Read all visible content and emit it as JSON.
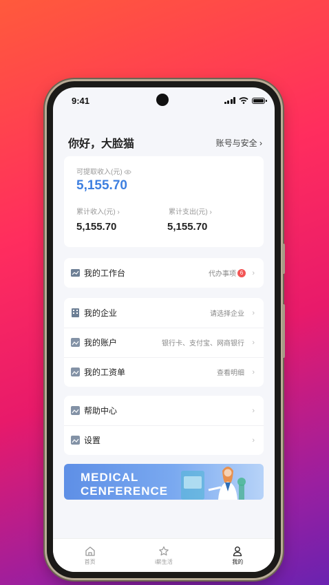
{
  "status": {
    "time": "9:41"
  },
  "header": {
    "greeting": "你好，大脸猫",
    "account_link": "账号与安全"
  },
  "summary": {
    "withdrawable_label": "可提取收入(元)",
    "withdrawable_value": "5,155.70",
    "total_income_label": "累计收入(元)",
    "total_income_value": "5,155.70",
    "total_expense_label": "累计支出(元)",
    "total_expense_value": "5,155.70"
  },
  "workbench": {
    "title": "我的工作台",
    "todo_label": "代办事项",
    "todo_count": "6"
  },
  "menu_group_1": {
    "enterprise": {
      "title": "我的企业",
      "hint": "请选择企业"
    },
    "account": {
      "title": "我的账户",
      "hint": "银行卡、支付宝、网商银行"
    },
    "payslip": {
      "title": "我的工资单",
      "hint": "查看明细"
    }
  },
  "menu_group_2": {
    "help": {
      "title": "帮助中心"
    },
    "settings": {
      "title": "设置"
    }
  },
  "banner": {
    "line1": "MEDICAL",
    "line2": "CENFERENCE"
  },
  "tabbar": {
    "home": "首页",
    "life": "i薪生活",
    "mine": "我的"
  },
  "colors": {
    "accent": "#3d7fe0",
    "badge": "#f25454"
  }
}
